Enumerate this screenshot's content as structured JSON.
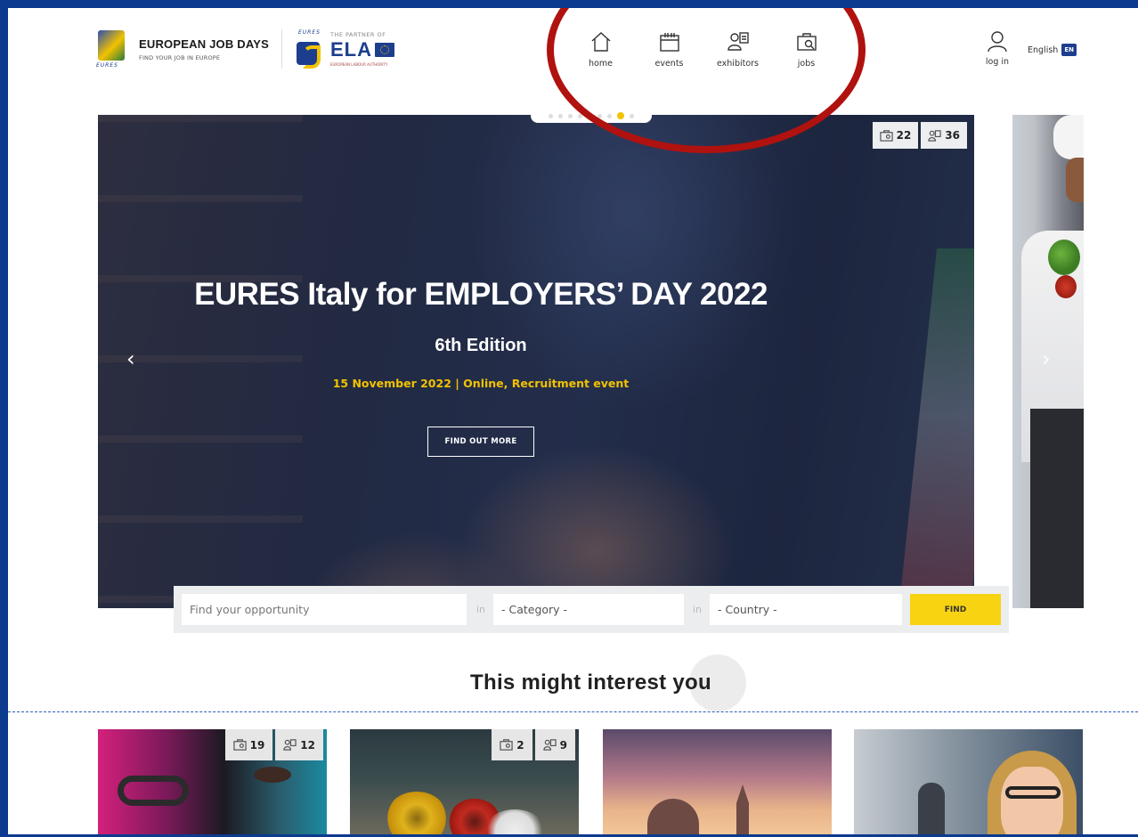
{
  "header": {
    "brand_title": "EUROPEAN JOB DAYS",
    "brand_subtitle": "FIND YOUR JOB IN EUROPE",
    "brand_caption": "EURES",
    "partner_caption": "EURES",
    "partner_label": "THE PARTNER OF",
    "partner_name": "ELA",
    "partner_fine": "EUROPEAN LABOUR AUTHORITY",
    "nav": [
      {
        "label": "home",
        "icon": "home-icon"
      },
      {
        "label": "events",
        "icon": "calendar-icon"
      },
      {
        "label": "exhibitors",
        "icon": "exhibitors-icon"
      },
      {
        "label": "jobs",
        "icon": "briefcase-icon"
      }
    ],
    "login_label": "log in",
    "language_label": "English",
    "language_badge": "EN"
  },
  "hero": {
    "title": "EURES Italy for EMPLOYERS’ DAY 2022",
    "edition": "6th Edition",
    "date_line": "15 November 2022 | Online, Recruitment event",
    "cta_label": "FIND OUT MORE",
    "prev_arrow": "‹",
    "next_arrow": "›",
    "jobs_count": "22",
    "exhibitors_count": "36",
    "slide_count": 9,
    "active_slide": 8
  },
  "search": {
    "opportunity_placeholder": "Find your opportunity",
    "in_label_1": "in",
    "category_value": "- Category -",
    "in_label_2": "in",
    "country_value": "- Country -",
    "find_label": "FIND"
  },
  "section": {
    "title": "This might interest you"
  },
  "cards": [
    {
      "jobs_count": "19",
      "exhibitors_count": "12"
    },
    {
      "jobs_count": "2",
      "exhibitors_count": "9"
    },
    {},
    {}
  ],
  "colors": {
    "frame": "#0b3a8e",
    "accent_yellow": "#f8d312",
    "brand_blue": "#1d3e8e",
    "highlight_red": "#b0120f"
  }
}
